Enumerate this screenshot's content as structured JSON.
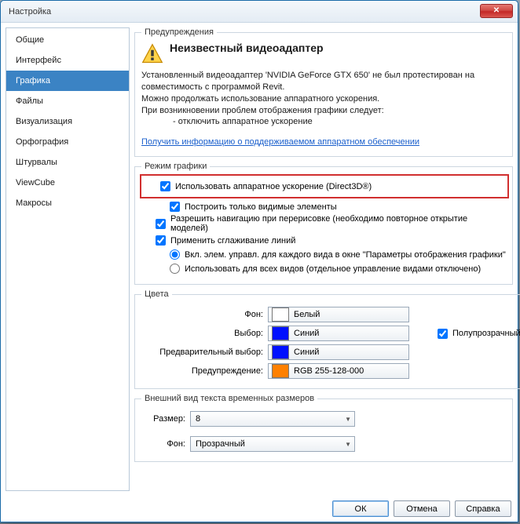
{
  "window": {
    "title": "Настройка"
  },
  "sidebar": {
    "items": [
      {
        "label": "Общие"
      },
      {
        "label": "Интерфейс"
      },
      {
        "label": "Графика",
        "active": true
      },
      {
        "label": "Файлы"
      },
      {
        "label": "Визуализация"
      },
      {
        "label": "Орфография"
      },
      {
        "label": "Штурвалы"
      },
      {
        "label": "ViewCube"
      },
      {
        "label": "Макросы"
      }
    ]
  },
  "warning": {
    "legend": "Предупреждения",
    "heading": "Неизвестный видеоадаптер",
    "line1": "Установленный видеоадаптер 'NVIDIA GeForce GTX 650' не был протестирован на совместимость с программой Revit.",
    "line2": "Можно продолжать использование аппаратного ускорения.",
    "line3": "При возникновении проблем отображения графики следует:",
    "line4": "- отключить аппаратное ускорение",
    "link": "Получить информацию о поддерживаемом аппаратном обеспечении"
  },
  "graphicsMode": {
    "legend": "Режим графики",
    "hwaccel": "Использовать аппаратное ускорение (Direct3D®)",
    "visibleOnly": "Построить только видимые элементы",
    "navRedraw": "Разрешить навигацию при перерисовке (необходимо повторное открытие моделей)",
    "smoothing": "Применить сглаживание линий",
    "radio1": "Вкл. элем. управл. для каждого вида в окне \"Параметры отображения графики\"",
    "radio2": "Использовать для всех видов (отдельное управление видами отключено)"
  },
  "colors": {
    "legend": "Цвета",
    "bgLabel": "Фон:",
    "bgName": "Белый",
    "bgHex": "#ffffff",
    "selLabel": "Выбор:",
    "selName": "Синий",
    "selHex": "#0010ff",
    "semiTrans": "Полупрозрачный",
    "preselLabel": "Предварительный выбор:",
    "preselName": "Синий",
    "preselHex": "#0010ff",
    "warnLabel": "Предупреждение:",
    "warnName": "RGB 255-128-000",
    "warnHex": "#ff8000"
  },
  "tempText": {
    "legend": "Внешний вид текста временных размеров",
    "sizeLabel": "Размер:",
    "sizeValue": "8",
    "bgLabel": "Фон:",
    "bgValue": "Прозрачный"
  },
  "buttons": {
    "ok": "ОК",
    "cancel": "Отмена",
    "help": "Справка"
  }
}
